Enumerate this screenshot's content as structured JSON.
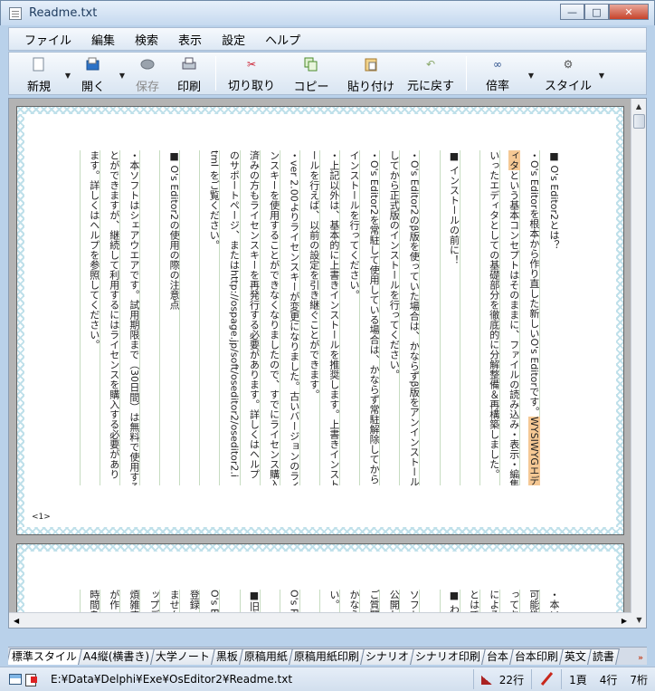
{
  "window": {
    "title": "Readme.txt",
    "controls": {
      "minimize": "—",
      "maximize": "□",
      "close": "✕"
    }
  },
  "menu": [
    "ファイル",
    "編集",
    "検索",
    "表示",
    "設定",
    "ヘルプ"
  ],
  "toolbar": {
    "new": "新規",
    "open": "開く",
    "save": "保存",
    "print": "印刷",
    "cut": "切り取り",
    "copy": "コピー",
    "paste": "貼り付け",
    "undo": "元に戻す",
    "zoom": "倍率",
    "style": "スタイル"
  },
  "page1": {
    "page_number": "<1>",
    "columns": [
      "■ O's Editor2とは？",
      "・O's Editorを根本から作り直した新しいO's Editorです。WYSIWYGエデ",
      "ィタという基本コンセプトはそのままに、ファイルの読み込み・表示・編集と",
      "いったエディタとしての基礎部分を徹底的に分解整備＆再構築しました。",
      "",
      "■ インストールの前に！",
      "",
      "・O's Editor2のβ版を使っていた場合は、かならずβ版をアンインストール",
      "してから正式版のインストールを行ってください。",
      "・O's Editor2を常駐して使用している場合は、かならず常駐解除してから",
      "インストールを行ってください。",
      "・上記以外は、基本的に上書きインストールを推奨します。上書きインスト",
      "ールを行えば、以前の設定を引き継ぐことができます。",
      "・ver 2.00よりライセンスキーが変更になりました。古いバージョンのライセ",
      "ンスキーを使用することができなくなりましたので、すでにライセンス購入",
      "済みの方もライセンスキーを再発行する必要があります。詳しくはヘルプ",
      "のサポートページ、またはhttp://ospage.jp/soft/oseditor2/oseditor2.i",
      "tml をご覧ください。",
      "",
      "■ O's Editor2の使用の際の注意点",
      "",
      "・本ソフトはシェアウエアです。試用期限まで（30日間）は無料で使用するこ",
      "とができますが、継続して利用するにはライセンスを購入する必要があり",
      "ます。詳しくはヘルプを参照してください。"
    ]
  },
  "page2": {
    "columns": [
      "・本ソフ",
      "可能性",
      "ってお",
      "による",
      "とはで",
      "■ わか",
      "",
      "ソフトに",
      "公開して",
      "ご質問",
      "かならず",
      "い。",
      "",
      "O's Pa",
      "",
      "■旧O'",
      "",
      "O's Edi",
      "登録",
      "ません",
      "ップデー",
      "煩雑す",
      "が作っ",
      "時間を"
    ]
  },
  "style_tabs": [
    "標準スタイル",
    "A4縦(横書き)",
    "大学ノート",
    "黒板",
    "原稿用紙",
    "原稿用紙印刷",
    "シナリオ",
    "シナリオ印刷",
    "台本",
    "台本印刷",
    "英文",
    "読書"
  ],
  "status": {
    "file_path": "E:¥Data¥Delphi¥Exe¥OsEditor2¥Readme.txt",
    "lines": "22行",
    "page": "1頁",
    "row": "4行",
    "column": "7桁"
  }
}
